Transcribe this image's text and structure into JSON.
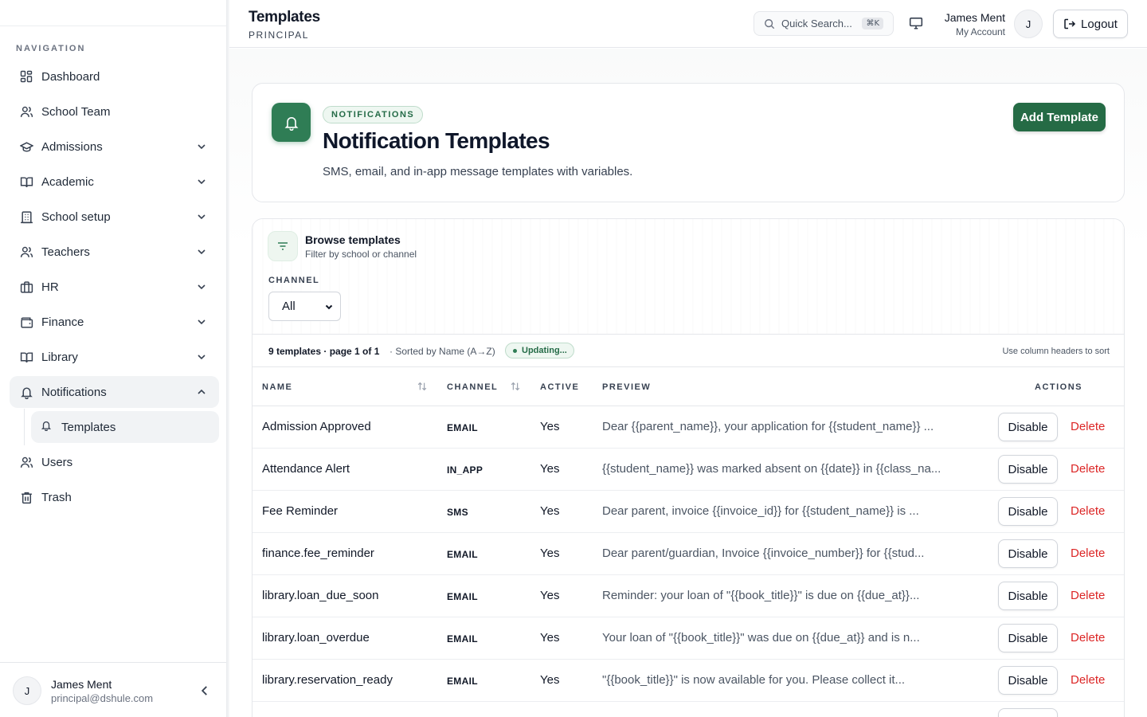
{
  "sidebar": {
    "heading": "NAVIGATION",
    "items": [
      {
        "label": "Dashboard",
        "icon": "dashboard-icon"
      },
      {
        "label": "School Team",
        "icon": "users-icon"
      },
      {
        "label": "Admissions",
        "icon": "graduation-cap-icon"
      },
      {
        "label": "Academic",
        "icon": "book-open-icon"
      },
      {
        "label": "School setup",
        "icon": "building-icon"
      },
      {
        "label": "Teachers",
        "icon": "users-icon"
      },
      {
        "label": "HR",
        "icon": "briefcase-icon"
      },
      {
        "label": "Finance",
        "icon": "wallet-icon"
      },
      {
        "label": "Library",
        "icon": "book-open-icon"
      },
      {
        "label": "Notifications",
        "icon": "bell-icon"
      },
      {
        "label": "Users",
        "icon": "users-icon"
      },
      {
        "label": "Trash",
        "icon": "trash-icon"
      }
    ],
    "sub_item": {
      "label": "Templates",
      "icon": "bell-icon"
    },
    "footer": {
      "avatar": "J",
      "name": "James Ment",
      "email": "principal@dshule.com"
    }
  },
  "header": {
    "title": "Templates",
    "subtitle": "PRINCIPAL",
    "search_placeholder": "Quick Search...",
    "search_shortcut": "⌘K",
    "user_name": "James Ment",
    "user_account": "My Account",
    "avatar": "J",
    "logout_label": "Logout"
  },
  "hero": {
    "badge": "NOTIFICATIONS",
    "title": "Notification Templates",
    "description": "SMS, email, and in-app message templates with variables.",
    "add_button": "Add Template"
  },
  "filter": {
    "title": "Browse templates",
    "subtitle": "Filter by school or channel",
    "channel_label": "CHANNEL",
    "channel_value": "All"
  },
  "status": {
    "count": "9 templates · page 1 of 1",
    "sort": "· Sorted by Name (A→Z)",
    "updating": "Updating...",
    "hint": "Use column headers to sort"
  },
  "table": {
    "headers": {
      "name": "NAME",
      "channel": "CHANNEL",
      "active": "ACTIVE",
      "preview": "PREVIEW",
      "actions": "ACTIONS"
    },
    "rows": [
      {
        "name": "Admission Approved",
        "channel": "EMAIL",
        "active": "Yes",
        "preview": "Dear {{parent_name}}, your application for {{student_name}} ...",
        "disable": "Disable",
        "delete": "Delete"
      },
      {
        "name": "Attendance Alert",
        "channel": "IN_APP",
        "active": "Yes",
        "preview": "{{student_name}} was marked absent on {{date}} in {{class_na...",
        "disable": "Disable",
        "delete": "Delete"
      },
      {
        "name": "Fee Reminder",
        "channel": "SMS",
        "active": "Yes",
        "preview": "Dear parent, invoice {{invoice_id}} for {{student_name}} is ...",
        "disable": "Disable",
        "delete": "Delete"
      },
      {
        "name": "finance.fee_reminder",
        "channel": "EMAIL",
        "active": "Yes",
        "preview": "Dear parent/guardian, Invoice {{invoice_number}} for {{stud...",
        "disable": "Disable",
        "delete": "Delete"
      },
      {
        "name": "library.loan_due_soon",
        "channel": "EMAIL",
        "active": "Yes",
        "preview": "Reminder: your loan of \"{{book_title}}\" is due on {{due_at}}...",
        "disable": "Disable",
        "delete": "Delete"
      },
      {
        "name": "library.loan_overdue",
        "channel": "EMAIL",
        "active": "Yes",
        "preview": "Your loan of \"{{book_title}}\" was due on {{due_at}} and is n...",
        "disable": "Disable",
        "delete": "Delete"
      },
      {
        "name": "library.reservation_ready",
        "channel": "EMAIL",
        "active": "Yes",
        "preview": "\"{{book_title}}\" is now available for you. Please collect it...",
        "disable": "Disable",
        "delete": "Delete"
      }
    ],
    "partial_row_disable": "Disable"
  }
}
